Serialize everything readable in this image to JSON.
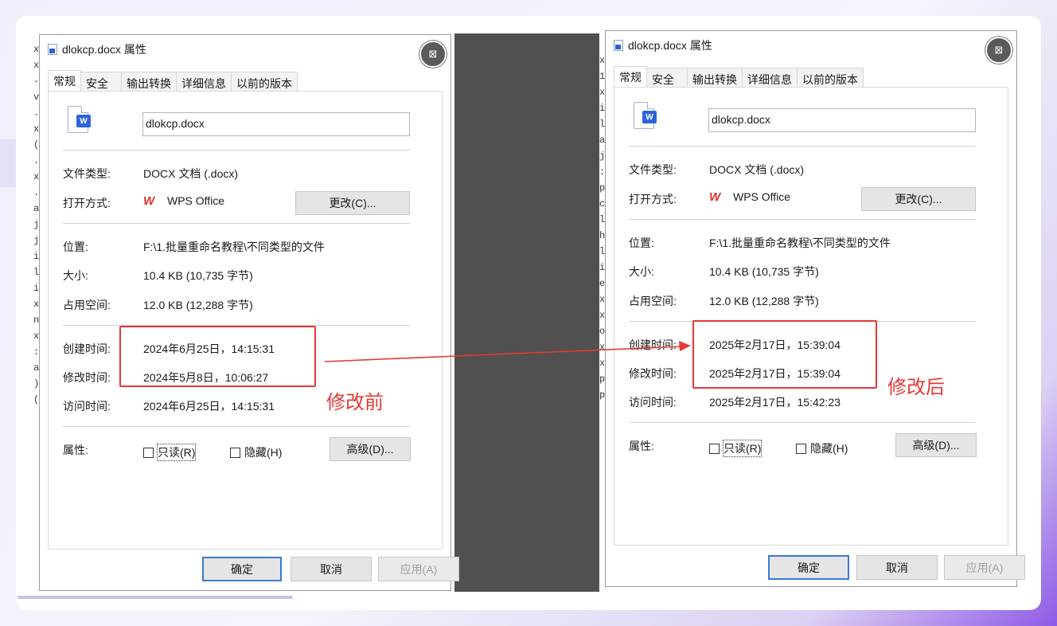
{
  "left_strip_chars": [
    "x",
    "x",
    "-",
    "v",
    ".",
    "x",
    "(",
    ".",
    "x",
    ".",
    "a",
    "j",
    "j",
    "i",
    "l",
    "i",
    "x",
    "n",
    "x",
    ":",
    "a",
    ")",
    "("
  ],
  "right_strip_chars": [
    "x",
    "1",
    "x",
    "i",
    "l",
    "a",
    "j",
    ":",
    "p",
    "c",
    "l",
    "h",
    "l",
    "i",
    "e",
    "x",
    "x",
    "o",
    "x",
    "x",
    "p",
    "p"
  ],
  "before": {
    "title": "dlokcp.docx 属性",
    "tabs": [
      "常规",
      "安全",
      "输出转换",
      "详细信息",
      "以前的版本"
    ],
    "filename": "dlokcp.docx",
    "rows": {
      "type_label": "文件类型:",
      "type_value": "DOCX 文档 (.docx)",
      "open_label": "打开方式:",
      "open_value": "WPS Office",
      "change_btn": "更改(C)...",
      "loc_label": "位置:",
      "loc_value": "F:\\1.批量重命名教程\\不同类型的文件",
      "size_label": "大小:",
      "size_value": "10.4 KB (10,735 字节)",
      "disk_label": "占用空间:",
      "disk_value": "12.0 KB (12,288 字节)",
      "created_label": "创建时间:",
      "created_value": "2024年6月25日，14:15:31",
      "modified_label": "修改时间:",
      "modified_value": "2024年5月8日，10:06:27",
      "accessed_label": "访问时间:",
      "accessed_value": "2024年6月25日，14:15:31",
      "attr_label": "属性:",
      "readonly": "只读(R)",
      "hidden": "隐藏(H)",
      "advanced_btn": "高级(D)..."
    },
    "ok": "确定",
    "cancel": "取消",
    "apply": "应用(A)",
    "annotation": "修改前"
  },
  "after": {
    "title": "dlokcp.docx 属性",
    "tabs": [
      "常规",
      "安全",
      "输出转换",
      "详细信息",
      "以前的版本"
    ],
    "filename": "dlokcp.docx",
    "rows": {
      "type_label": "文件类型:",
      "type_value": "DOCX 文档 (.docx)",
      "open_label": "打开方式:",
      "open_value": "WPS Office",
      "change_btn": "更改(C)...",
      "loc_label": "位置:",
      "loc_value": "F:\\1.批量重命名教程\\不同类型的文件",
      "size_label": "大小:",
      "size_value": "10.4 KB (10,735 字节)",
      "disk_label": "占用空间:",
      "disk_value": "12.0 KB (12,288 字节)",
      "created_label": "创建时间:",
      "created_value": "2025年2月17日，15:39:04",
      "modified_label": "修改时间:",
      "modified_value": "2025年2月17日，15:39:04",
      "accessed_label": "访问时间:",
      "accessed_value": "2025年2月17日，15:42:23",
      "attr_label": "属性:",
      "readonly": "只读(R)",
      "hidden": "隐藏(H)",
      "advanced_btn": "高级(D)..."
    },
    "ok": "确定",
    "cancel": "取消",
    "apply": "应用(A)",
    "annotation": "修改后"
  },
  "colors": {
    "annotation_red": "#e53935",
    "brand_purple": "#8e5ae6"
  }
}
